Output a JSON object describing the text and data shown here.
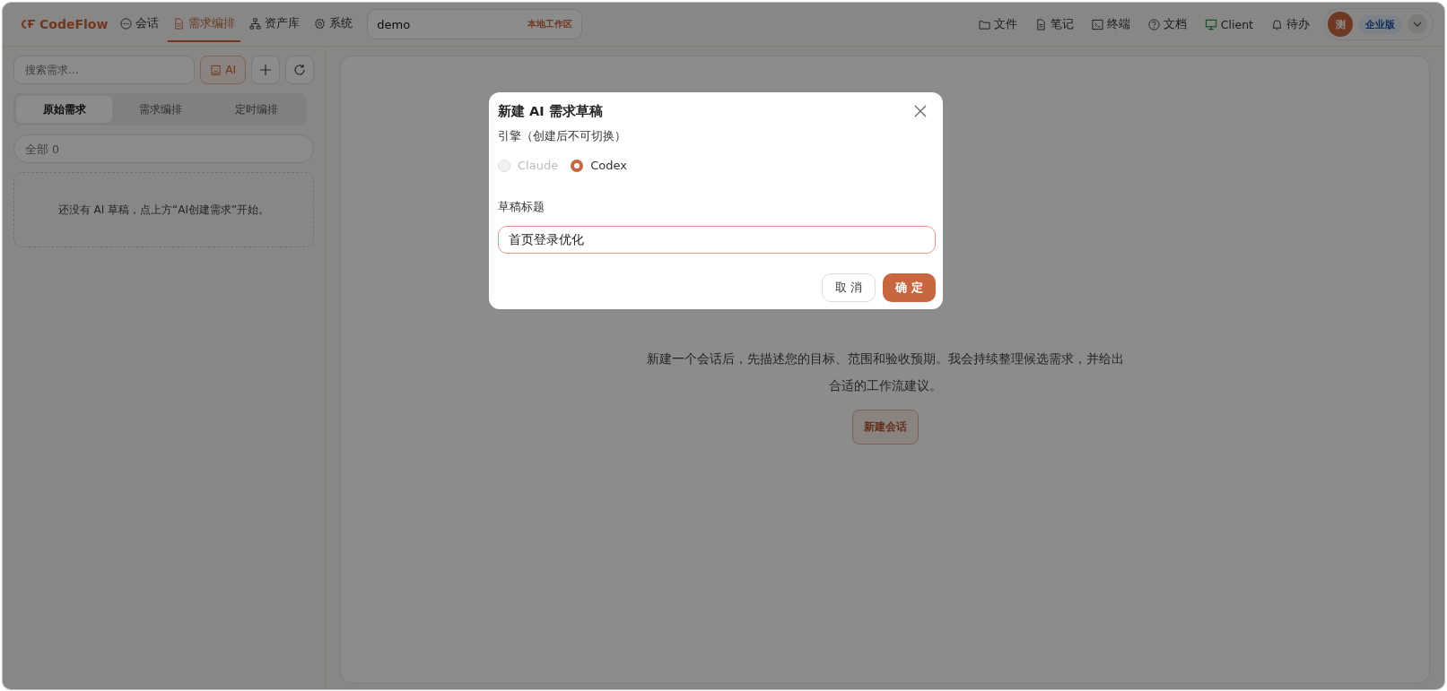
{
  "header": {
    "logo": "CodeFlow",
    "nav": [
      {
        "label": "会话",
        "selected": false
      },
      {
        "label": "需求编排",
        "selected": true
      },
      {
        "label": "资产库",
        "selected": false
      },
      {
        "label": "系统",
        "selected": false
      }
    ],
    "workspace": {
      "value": "demo",
      "badge": "本地工作区"
    },
    "tools": [
      {
        "label": "文件"
      },
      {
        "label": "笔记"
      },
      {
        "label": "终端"
      },
      {
        "label": "文档"
      },
      {
        "label": "Client"
      },
      {
        "label": "待办"
      }
    ],
    "user": {
      "avatar": "测",
      "plan": "企业版"
    }
  },
  "sidebar": {
    "search": {
      "placeholder": "搜索需求..."
    },
    "ai_button": "AI",
    "tabs": [
      {
        "label": "原始需求",
        "selected": true
      },
      {
        "label": "需求编排",
        "selected": false
      },
      {
        "label": "定时编排",
        "selected": false
      }
    ],
    "filter": {
      "placeholder": "全部 0"
    },
    "empty": "还没有 AI 草稿，点上方“AI创建需求”开始。"
  },
  "main": {
    "description": "新建一个会话后，先描述您的目标、范围和验收预期。我会持续整理候选需求，并给出合适的工作流建议。",
    "button": "新建会话"
  },
  "dialog": {
    "title": "新建 AI 需求草稿",
    "engine_label": "引擎（创建后不可切换）",
    "engines": [
      {
        "label": "Claude",
        "selected": false,
        "disabled": true
      },
      {
        "label": "Codex",
        "selected": true,
        "disabled": false
      }
    ],
    "title_label": "草稿标题",
    "title_value": "首页登录优化",
    "cancel": "取 消",
    "ok": "确 定"
  }
}
